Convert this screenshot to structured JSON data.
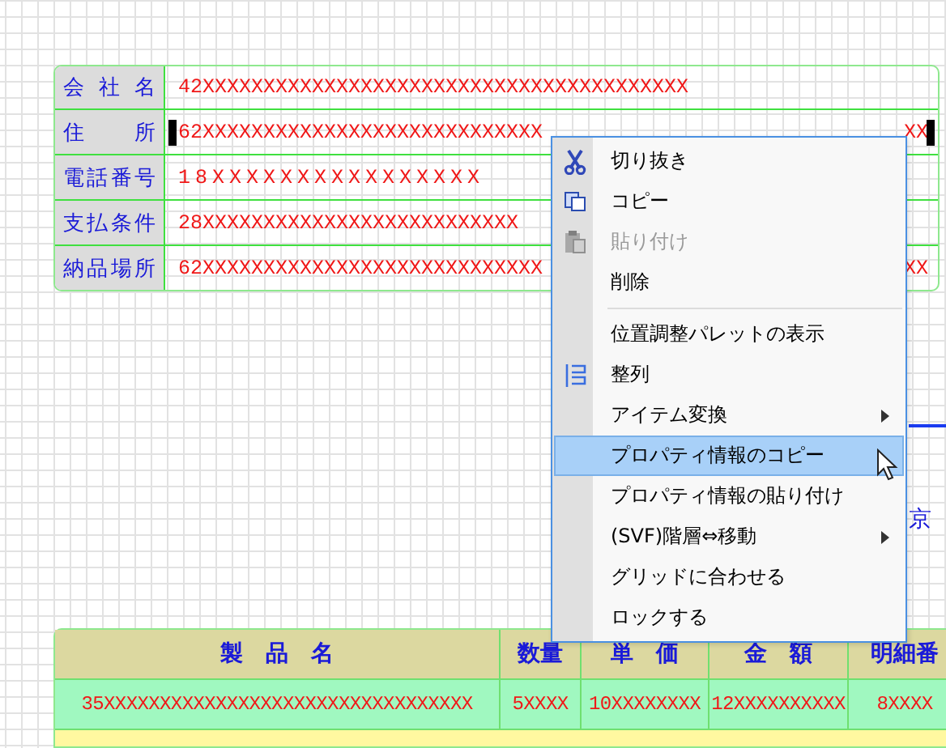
{
  "form": {
    "rows": [
      {
        "label": "会社名",
        "parts": [
          "42XXXXXXXXXXXXXXXXXXXXXXXXXXXXXXXXXXXXXXXX"
        ],
        "selected": false,
        "spaced": false
      },
      {
        "label": "住所",
        "parts": [
          "62XXXXXXXXXXXXXXXXXXXXXXXXXXXX",
          "XX"
        ],
        "selected": true,
        "spaced": false
      },
      {
        "label": "電話番号",
        "parts": [
          "18XXXXXXXXXXXXXXXX"
        ],
        "selected": false,
        "spaced": true
      },
      {
        "label": "支払条件",
        "parts": [
          "28XXXXXXXXXXXXXXXXXXXXXXXXXX"
        ],
        "selected": false,
        "spaced": false
      },
      {
        "label": "納品場所",
        "parts": [
          "62XXXXXXXXXXXXXXXXXXXXXXXXXXXX",
          "XX"
        ],
        "selected": false,
        "spaced": false
      }
    ]
  },
  "side_text": "京",
  "table": {
    "columns": [
      "製　品　名",
      "数量",
      "単　価",
      "金　額",
      "明細番"
    ],
    "row": [
      "35XXXXXXXXXXXXXXXXXXXXXXXXXXXXXXXXX",
      "5XXXX",
      "10XXXXXXXX",
      "12XXXXXXXXXX",
      "8XXXX"
    ]
  },
  "context_menu": {
    "items": [
      {
        "kind": "item",
        "label": "切り抜き",
        "disabled": false,
        "submenu": false,
        "selected": false
      },
      {
        "kind": "item",
        "label": "コピー",
        "disabled": false,
        "submenu": false,
        "selected": false
      },
      {
        "kind": "item",
        "label": "貼り付け",
        "disabled": true,
        "submenu": false,
        "selected": false
      },
      {
        "kind": "item",
        "label": "削除",
        "disabled": false,
        "submenu": false,
        "selected": false
      },
      {
        "kind": "separator"
      },
      {
        "kind": "item",
        "label": "位置調整パレットの表示",
        "disabled": false,
        "submenu": false,
        "selected": false
      },
      {
        "kind": "item",
        "label": "整列",
        "disabled": false,
        "submenu": false,
        "selected": false
      },
      {
        "kind": "item",
        "label": "アイテム変換",
        "disabled": false,
        "submenu": true,
        "selected": false
      },
      {
        "kind": "item",
        "label": "プロパティ情報のコピー",
        "disabled": false,
        "submenu": false,
        "selected": true
      },
      {
        "kind": "item",
        "label": "プロパティ情報の貼り付け",
        "disabled": false,
        "submenu": false,
        "selected": false
      },
      {
        "kind": "item",
        "label": "(SVF)階層⇔移動",
        "disabled": false,
        "submenu": true,
        "selected": false
      },
      {
        "kind": "item",
        "label": "グリッドに合わせる",
        "disabled": false,
        "submenu": false,
        "selected": false
      },
      {
        "kind": "item",
        "label": "ロックする",
        "disabled": false,
        "submenu": false,
        "selected": false
      }
    ]
  }
}
